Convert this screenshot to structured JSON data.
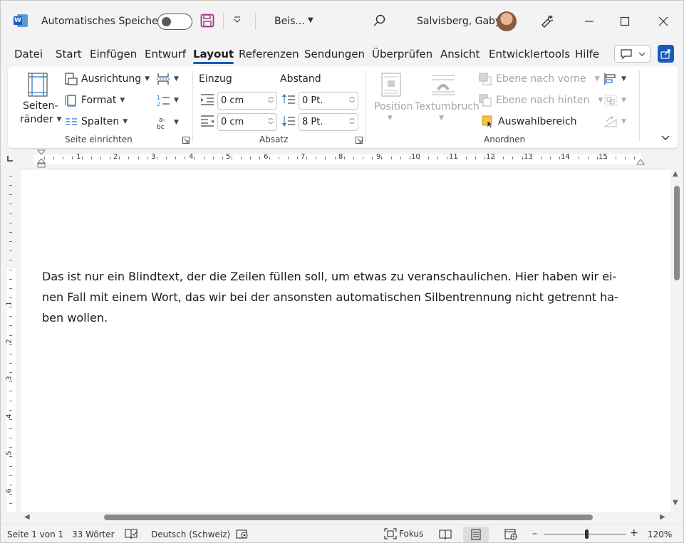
{
  "titlebar": {
    "autosave_label": "Automatisches Speichern",
    "doc_title": "Beis...",
    "user_name": "Salvisberg, Gaby"
  },
  "menu": {
    "tabs": [
      "Datei",
      "Start",
      "Einfügen",
      "Entwurf",
      "Layout",
      "Referenzen",
      "Sendungen",
      "Überprüfen",
      "Ansicht",
      "Entwicklertools",
      "Hilfe"
    ],
    "active_tab": "Layout"
  },
  "ribbon": {
    "seite_einrichten": {
      "margins_label_1": "Seiten-",
      "margins_label_2": "ränder",
      "orientation": "Ausrichtung",
      "format": "Format",
      "columns": "Spalten",
      "group_label": "Seite einrichten"
    },
    "absatz": {
      "einzug_label": "Einzug",
      "abstand_label": "Abstand",
      "indent_left": "0 cm",
      "indent_right": "0 cm",
      "spacing_before": "0 Pt.",
      "spacing_after": "8 Pt.",
      "group_label": "Absatz"
    },
    "anordnen": {
      "position": "Position",
      "wrap_text": "Textumbruch",
      "bring_forward": "Ebene nach vorne",
      "send_backward": "Ebene nach hinten",
      "selection_pane": "Auswahlbereich",
      "group_label": "Anordnen"
    }
  },
  "ruler": {
    "horizontal_numbers": [
      "1",
      "2",
      "3",
      "4",
      "5",
      "6",
      "7",
      "8",
      "9",
      "10",
      "11",
      "12",
      "13",
      "14",
      "15"
    ],
    "vertical_numbers": [
      "1",
      "2",
      "3",
      "4",
      "5",
      "6"
    ]
  },
  "document": {
    "lines": [
      "Das ist nur ein Blindtext, der die Zeilen füllen soll, um etwas zu veranschaulichen. Hier haben wir ei-",
      "nen Fall mit einem Wort, das wir bei der ansonsten automatischen Silbentrennung nicht getrennt ha-",
      "ben wollen."
    ]
  },
  "statusbar": {
    "page": "Seite 1 von 1",
    "words": "33 Wörter",
    "language": "Deutsch (Schweiz)",
    "focus": "Fokus",
    "zoom": "120%",
    "zoom_minus": "–",
    "zoom_plus": "+"
  },
  "colors": {
    "accent": "#185abd",
    "save_icon": "#a4378f"
  }
}
